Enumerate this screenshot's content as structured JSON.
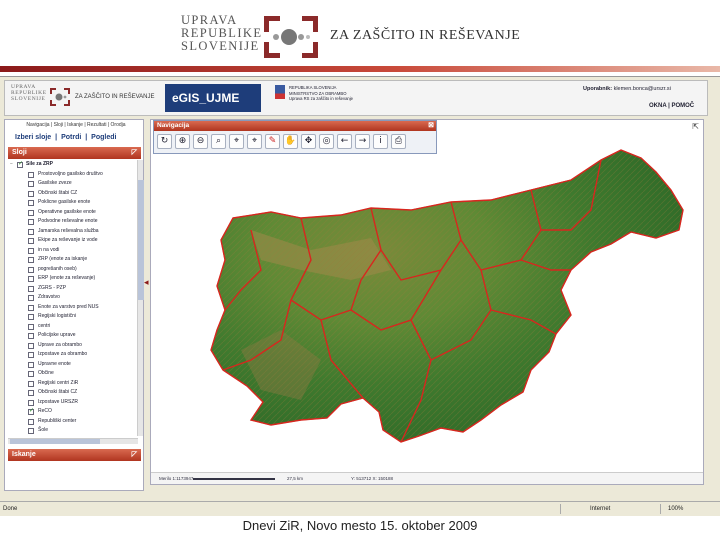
{
  "slide": {
    "logo_lines": [
      "UPRAVA",
      "REPUBLIKE",
      "SLOVENIJE"
    ],
    "logo_tagline": "ZA ZAŠČITO IN REŠEVANJE",
    "caption": "Dnevi ZiR, Novo mesto 15. oktober 2009",
    "rule_colors": [
      "#8b1a1a",
      "#c94a3a",
      "#e9b8a8"
    ]
  },
  "app": {
    "mini_logo_lines": [
      "UPRAVA",
      "REPUBLIKE",
      "SLOVENIJE"
    ],
    "mini_tagline": "ZA ZAŠČITO IN REŠEVANJE",
    "title": "eGIS_UJME",
    "gov_lines": [
      "REPUBLIKA SLOVENIJA",
      "MINISTRSTVO ZA OBRAMBO",
      "Uprava RS za zaščito in reševanje"
    ],
    "user_label": "Uporabnik:",
    "user_name": "klemen.bonca@urszr.si",
    "header_links": "OKNA | POMOČ"
  },
  "left_panel": {
    "menu_strip": "Navigacija | Sloji | Iskanje | Rezultati | Orodja",
    "tabs": [
      "Izberi sloje",
      "|",
      "Potrdi",
      "|",
      "Pogledi"
    ],
    "layers_title": "Sloji",
    "search_title": "Iskanje",
    "layers": [
      {
        "level": 0,
        "checked": true,
        "label": "Sile za ZRP"
      },
      {
        "level": 1,
        "checked": false,
        "label": "Prostovoljno gasilsko društvo"
      },
      {
        "level": 1,
        "checked": false,
        "label": "Gasilske zveze"
      },
      {
        "level": 1,
        "checked": false,
        "label": "Občinski štabi CZ"
      },
      {
        "level": 1,
        "checked": false,
        "label": "Poklicne gasilske enote"
      },
      {
        "level": 1,
        "checked": false,
        "label": "Operativne gasilske enote"
      },
      {
        "level": 1,
        "checked": false,
        "label": "Podvodne reševalne enote"
      },
      {
        "level": 1,
        "checked": false,
        "label": "Jamarska reševalna služba"
      },
      {
        "level": 1,
        "checked": false,
        "label": "Ekipe za reševanje iz vode"
      },
      {
        "level": 1,
        "checked": false,
        "label": "in na vodi"
      },
      {
        "level": 1,
        "checked": false,
        "label": "ZRP (enote za iskanje"
      },
      {
        "level": 1,
        "checked": false,
        "label": "pogrešanih oseb)"
      },
      {
        "level": 1,
        "checked": false,
        "label": "ERP (enote za reševanje)"
      },
      {
        "level": 1,
        "checked": false,
        "label": "ZGRS - PZP"
      },
      {
        "level": 1,
        "checked": false,
        "label": "Zdravstvo"
      },
      {
        "level": 1,
        "checked": false,
        "label": "Enote za varstvo pred NUS"
      },
      {
        "level": 1,
        "checked": false,
        "label": "Regijski logistični"
      },
      {
        "level": 1,
        "checked": false,
        "label": "centri"
      },
      {
        "level": 1,
        "checked": false,
        "label": "Policijske uprave"
      },
      {
        "level": 1,
        "checked": false,
        "label": "Uprave za obrambo"
      },
      {
        "level": 1,
        "checked": false,
        "label": "Izpostave za obrambo"
      },
      {
        "level": 1,
        "checked": false,
        "label": "Upravne enote"
      },
      {
        "level": 1,
        "checked": false,
        "label": "Občine"
      },
      {
        "level": 1,
        "checked": false,
        "label": "Regijski centri ZiR"
      },
      {
        "level": 1,
        "checked": false,
        "label": "Občinski štabi CZ"
      },
      {
        "level": 1,
        "checked": false,
        "label": "Izpostave URSZR"
      },
      {
        "level": 1,
        "checked": true,
        "label": "ReCO"
      },
      {
        "level": 1,
        "checked": false,
        "label": "Republiški center"
      },
      {
        "level": 1,
        "checked": false,
        "label": "Šole"
      }
    ]
  },
  "navigation": {
    "title": "Navigacija",
    "close": "⊠",
    "tools": [
      {
        "name": "refresh-icon",
        "glyph": "↻"
      },
      {
        "name": "zoom-in-icon",
        "glyph": "⊕"
      },
      {
        "name": "zoom-out-icon",
        "glyph": "⊖"
      },
      {
        "name": "zoom-box-icon",
        "glyph": "⌕"
      },
      {
        "name": "zoom-prev-icon",
        "glyph": "⌖"
      },
      {
        "name": "zoom-next-icon",
        "glyph": "⌖"
      },
      {
        "name": "measure-icon",
        "glyph": "✎"
      },
      {
        "name": "pan-icon",
        "glyph": "✋"
      },
      {
        "name": "select-icon",
        "glyph": "✥"
      },
      {
        "name": "globe-icon",
        "glyph": "◎"
      },
      {
        "name": "back-icon",
        "glyph": "←"
      },
      {
        "name": "forward-icon",
        "glyph": "→"
      },
      {
        "name": "info-icon",
        "glyph": "i"
      },
      {
        "name": "print-icon",
        "glyph": "⎙"
      }
    ]
  },
  "map_status": {
    "scale_label": "Merilo 1:1173947",
    "scale_text": "27,5 km",
    "coords": "Y: 513712 X: 150188"
  },
  "ie_status": {
    "done": "Done",
    "zone": "Internet",
    "zoom": "100%"
  }
}
